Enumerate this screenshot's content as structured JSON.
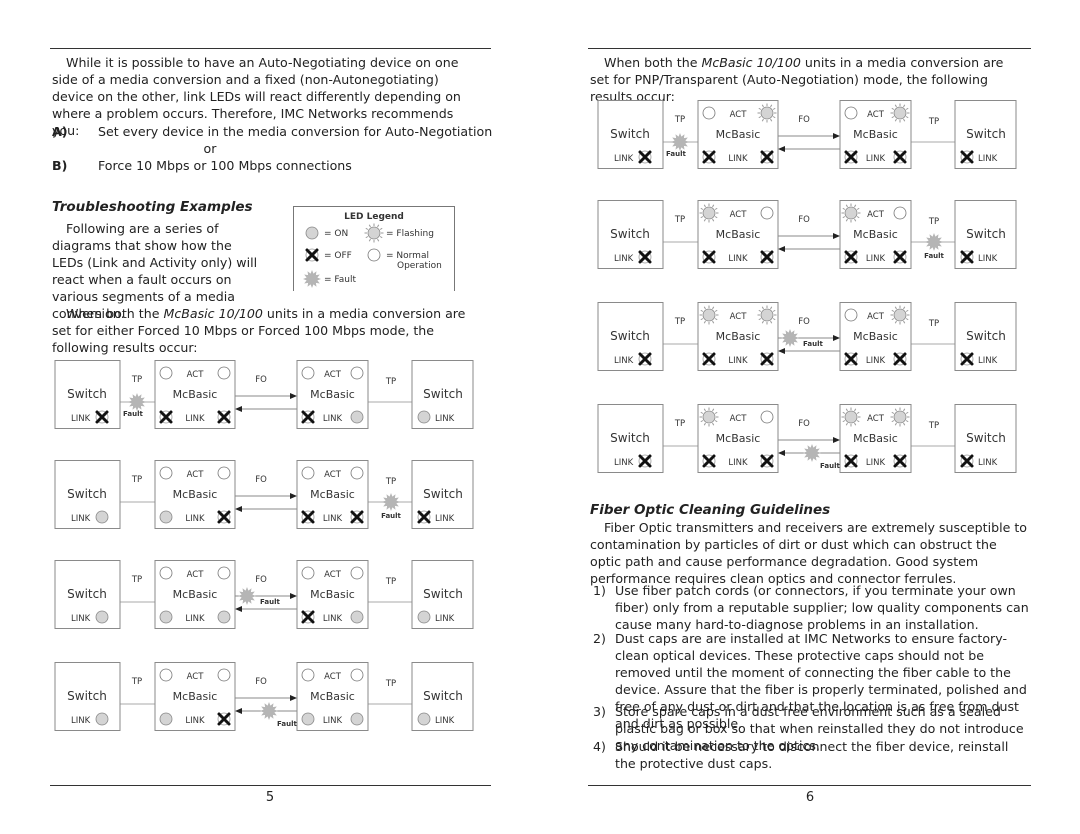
{
  "left_page": {
    "intro": "While it is possible to have an Auto-Negotiating device on one side of a media conversion and a fixed (non-Autonegotiating) device on the other, link LEDs will react differently depending on where a problem occurs. Therefore, IMC Networks recommends you:",
    "options": [
      {
        "marker": "A)",
        "text": "Set every device in the media conversion for Auto-Negotiation"
      },
      {
        "marker": "B)",
        "text": "Force 10 Mbps or 100 Mbps connections"
      }
    ],
    "or": "or",
    "heading": "Troubleshooting Examples",
    "examples_text": "Following are a series of diagrams that show how the LEDs (Link and Activity only) will react when a fault occurs on various segments of a media conversion.",
    "forced_text": {
      "pre": "When both the ",
      "em": "McBasic 10/100",
      "post": " units in a media conversion are set for either Forced 10 Mbps or Forced 100 Mbps mode, the following results occur:"
    },
    "page_number": "5"
  },
  "legend": {
    "title": "LED Legend",
    "on": "= ON",
    "off": "= OFF",
    "flashing": "= Flashing",
    "normal": "= Normal",
    "normal2": "Operation",
    "fault": "= Fault"
  },
  "diagram_labels": {
    "switch": "Switch",
    "mcbasic": "McBasic",
    "act": "ACT",
    "link": "LINK",
    "tp": "TP",
    "fo": "FO",
    "fault": "Fault"
  },
  "forced_diagrams": [
    {
      "fault": "tp1",
      "sw1": "off",
      "m1": [
        "normal",
        "normal",
        "off",
        "off"
      ],
      "m2": [
        "normal",
        "normal",
        "off",
        "on"
      ],
      "sw2": "on"
    },
    {
      "fault": "tp2",
      "sw1": "on",
      "m1": [
        "normal",
        "normal",
        "on",
        "off"
      ],
      "m2": [
        "normal",
        "normal",
        "off",
        "off"
      ],
      "sw2": "off"
    },
    {
      "fault": "fo_tx",
      "sw1": "on",
      "m1": [
        "normal",
        "normal",
        "on",
        "on"
      ],
      "m2": [
        "normal",
        "normal",
        "off",
        "on"
      ],
      "sw2": "on"
    },
    {
      "fault": "fo_rx",
      "sw1": "on",
      "m1": [
        "normal",
        "normal",
        "on",
        "off"
      ],
      "m2": [
        "normal",
        "normal",
        "on",
        "on"
      ],
      "sw2": "on"
    }
  ],
  "right_page": {
    "pnp_text": {
      "pre": "When both the ",
      "em": "McBasic 10/100",
      "post": " units in a media conversion are set for PNP/Transparent (Auto-Negotiation) mode, the following results occur:"
    },
    "heading": "Fiber Optic Cleaning Guidelines",
    "cleaning_intro": "Fiber Optic transmitters and receivers are extremely susceptible to contamination by particles of dirt or dust which can obstruct the optic path and cause performance degradation.  Good system performance requires clean optics and connector ferrules.",
    "items": [
      {
        "n": "1)",
        "text": "Use fiber patch cords (or connectors, if you terminate your own fiber) only from a reputable supplier; low quality components can cause many hard-to-diagnose problems in an installation."
      },
      {
        "n": "2)",
        "text": "Dust caps are are installed at IMC Networks to ensure factory-clean optical devices.  These protective caps should not be removed until the moment of connecting the fiber cable to the device.  Assure that the fiber is properly terminated, polished and free of any dust or dirt and that the location is as free from dust and dirt as possible."
      },
      {
        "n": "3)",
        "text": "Store spare caps in a dust free environment such as a sealed plastic bag or box so that when reinstalled they do not introduce any contamination to the optics."
      },
      {
        "n": "4)",
        "text": "Should it be necessary to disconnect the fiber device, reinstall the protective dust caps."
      }
    ],
    "page_number": "6"
  },
  "pnp_diagrams": [
    {
      "fault": "tp1",
      "sw1": "off",
      "m1": [
        "normal",
        "flashing",
        "off",
        "off"
      ],
      "m2": [
        "normal",
        "flashing",
        "off",
        "off"
      ],
      "sw2": "off"
    },
    {
      "fault": "tp2",
      "sw1": "off",
      "m1": [
        "flashing",
        "normal",
        "off",
        "off"
      ],
      "m2": [
        "flashing",
        "normal",
        "off",
        "off"
      ],
      "sw2": "off"
    },
    {
      "fault": "fo_tx",
      "sw1": "off",
      "m1": [
        "flashing",
        "flashing",
        "off",
        "off"
      ],
      "m2": [
        "normal",
        "flashing",
        "off",
        "off"
      ],
      "sw2": "off"
    },
    {
      "fault": "fo_rx",
      "sw1": "off",
      "m1": [
        "flashing",
        "normal",
        "off",
        "off"
      ],
      "m2": [
        "flashing",
        "flashing",
        "off",
        "off"
      ],
      "sw2": "off"
    }
  ],
  "colors": {
    "led_on": "#d4d4d4",
    "fault": "#b5b5b5",
    "box_border": "#8a8a8a"
  }
}
